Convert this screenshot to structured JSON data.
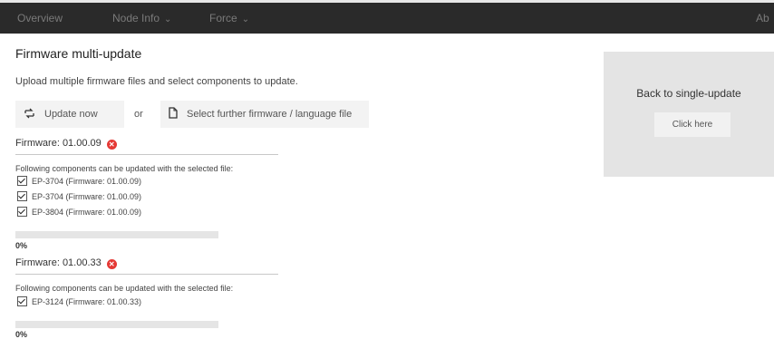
{
  "nav": {
    "items": [
      {
        "label": "Overview",
        "dropdown": false
      },
      {
        "label": "Node Info",
        "dropdown": true
      },
      {
        "label": "Force",
        "dropdown": true
      }
    ],
    "right_truncated": "Ab"
  },
  "page": {
    "title": "Firmware multi-update",
    "subtitle": "Upload multiple firmware files and select components to update."
  },
  "actions": {
    "update_now": "Update now",
    "or": "or",
    "select_file": "Select further firmware / language file"
  },
  "firmware_groups": [
    {
      "header": "Firmware: 01.00.09",
      "note": "Following components can be updated with the selected file:",
      "components": [
        {
          "label": "EP-3704  (Firmware: 01.00.09)",
          "checked": true
        },
        {
          "label": "EP-3704  (Firmware: 01.00.09)",
          "checked": true
        },
        {
          "label": "EP-3804  (Firmware: 01.00.09)",
          "checked": true
        }
      ],
      "progress_percent": 0,
      "progress_text": "0%"
    },
    {
      "header": "Firmware: 01.00.33",
      "note": "Following components can be updated with the selected file:",
      "components": [
        {
          "label": "EP-3124  (Firmware: 01.00.33)",
          "checked": true
        }
      ],
      "progress_percent": 0,
      "progress_text": "0%"
    }
  ],
  "side_panel": {
    "title": "Back to single-update",
    "button": "Click here"
  },
  "icons": {
    "update": "refresh-arrows-icon",
    "file": "document-icon",
    "error": "error-x-icon",
    "chevron": "chevron-down-icon"
  },
  "colors": {
    "topbar": "#2a2a2a",
    "error": "#e53935",
    "panel": "#e4e4e4"
  }
}
